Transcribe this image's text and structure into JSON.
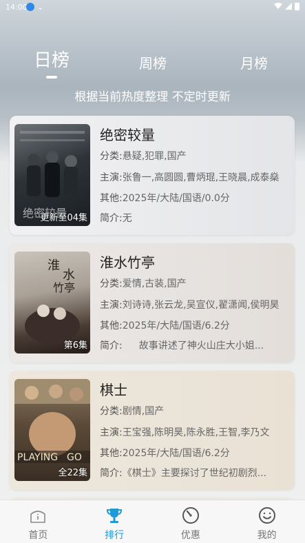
{
  "status_bar": {
    "time": "14:00"
  },
  "tabs": [
    {
      "label": "日榜",
      "active": true
    },
    {
      "label": "周榜",
      "active": false
    },
    {
      "label": "月榜",
      "active": false
    }
  ],
  "subtitle": "根据当前热度整理 不定时更新",
  "items": [
    {
      "title": "绝密较量",
      "badge": "更新至04集",
      "category_label": "分类:",
      "category": "悬疑,犯罪,国产",
      "cast_label": "主演:",
      "cast": "张鲁一,高圆圆,曹炳琨,王晓晨,成泰燊",
      "other_label": "其他:",
      "other": "2025年/大陆/国语/0.0分",
      "intro_label": "简介:",
      "intro": "无"
    },
    {
      "title": "淮水竹亭",
      "badge": "第6集",
      "category_label": "分类:",
      "category": "爱情,古装,国产",
      "cast_label": "主演:",
      "cast": "刘诗诗,张云龙,吴宣仪,翟潇闻,侯明昊",
      "other_label": "其他:",
      "other": "2025年/大陆/国语/6.2分",
      "intro_label": "简介:",
      "intro": "故事讲述了神火山庄大小姐..."
    },
    {
      "title": "棋士",
      "badge": "全22集",
      "category_label": "分类:",
      "category": "剧情,国产",
      "cast_label": "主演:",
      "cast": "王宝强,陈明昊,陈永胜,王智,李乃文",
      "other_label": "其他:",
      "other": "2025年/大陆/国语/6.2分",
      "intro_label": "简介:",
      "intro": "《棋士》主要探讨了世纪初剧烈..."
    }
  ],
  "bottom_nav": [
    {
      "label": "首页",
      "icon": "home-icon",
      "active": false
    },
    {
      "label": "排行",
      "icon": "trophy-icon",
      "active": true
    },
    {
      "label": "优惠",
      "icon": "gauge-icon",
      "active": false
    },
    {
      "label": "我的",
      "icon": "smiley-icon",
      "active": false
    }
  ],
  "colors": {
    "accent": "#1e9ad6"
  }
}
